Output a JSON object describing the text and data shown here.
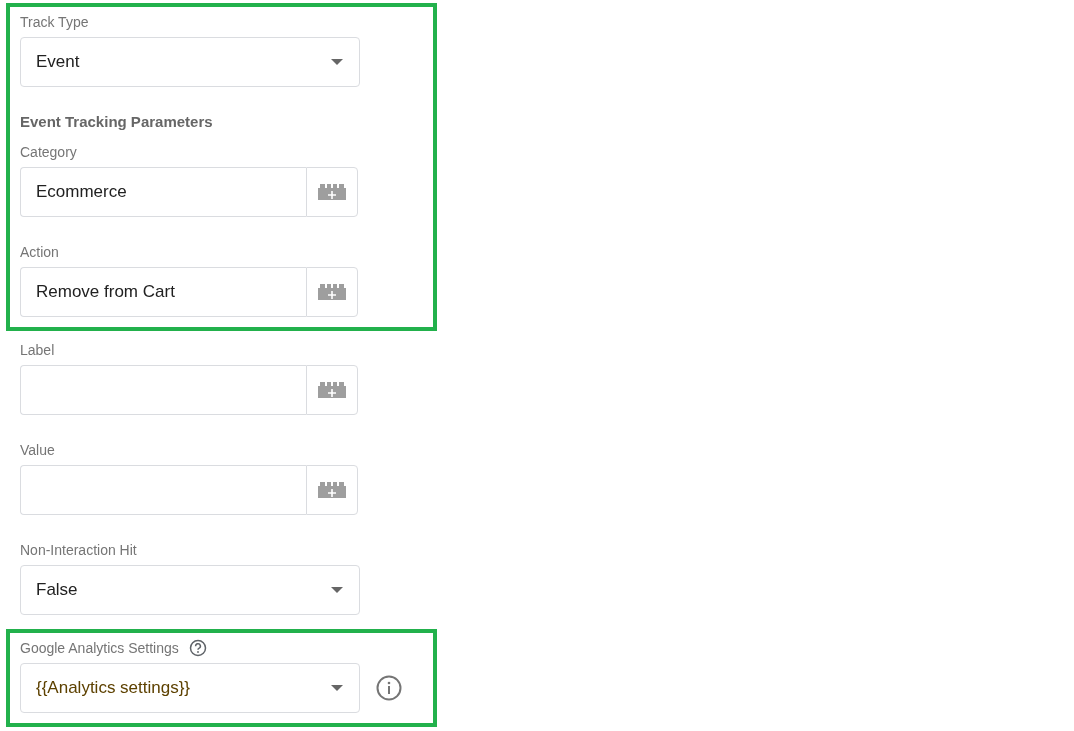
{
  "groups": [
    {
      "highlighted": true,
      "items": [
        {
          "kind": "select",
          "label": "Track Type",
          "value": "Event"
        },
        {
          "kind": "heading",
          "text": "Event Tracking Parameters"
        },
        {
          "kind": "text",
          "label": "Category",
          "value": "Ecommerce"
        },
        {
          "kind": "text",
          "label": "Action",
          "value": "Remove from Cart"
        }
      ]
    },
    {
      "highlighted": false,
      "items": [
        {
          "kind": "text",
          "label": "Label",
          "value": ""
        },
        {
          "kind": "text",
          "label": "Value",
          "value": ""
        },
        {
          "kind": "select",
          "label": "Non-Interaction Hit",
          "value": "False"
        }
      ]
    },
    {
      "highlighted": true,
      "items": [
        {
          "kind": "select",
          "label": "Google Analytics Settings",
          "value": "{{Analytics settings}}",
          "variable": true,
          "help": true,
          "info": true
        }
      ]
    }
  ]
}
